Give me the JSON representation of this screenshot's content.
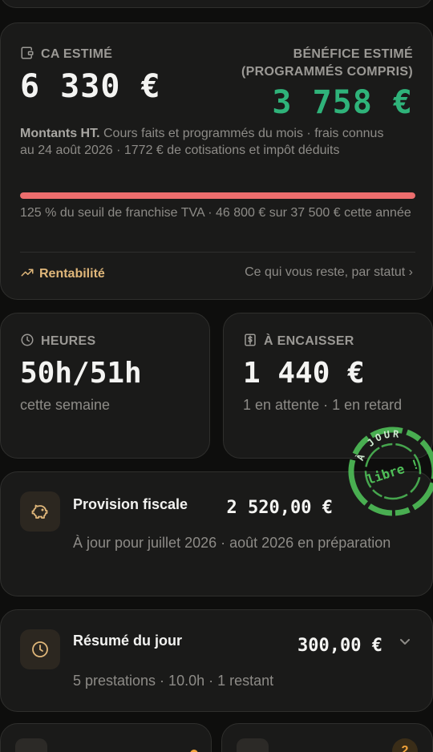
{
  "revenue_card": {
    "ca_label": "CA ESTIMÉ",
    "ca_value": "6 330 €",
    "benefice_label": "BÉNÉFICE ESTIMÉ (PROGRAMMÉS COMPRIS)",
    "benefice_value": "3 758 €",
    "desc_bold": "Montants HT.",
    "desc_text": " Cours faits et programmés du mois · frais connus au 24 août 2026 · 1772 € de cotisations et impôt déduits",
    "tva_progress_percent": 125,
    "tva_note": "125 % du seuil de franchise TVA · 46 800 € sur 37 500 € cette année",
    "rentabilite_link": "Rentabilité",
    "reste_link": "Ce qui vous reste, par statut ›",
    "colors": {
      "benefice": "#2fb37a",
      "progress": "#ec6d6d",
      "accent": "#e0b77a"
    }
  },
  "hours_card": {
    "label": "HEURES",
    "value": "50h/51h",
    "sub": "cette semaine",
    "icon": "clock-icon"
  },
  "cash_card": {
    "label": "À ENCAISSER",
    "value": "1 440 €",
    "sub": "1 en attente · 1 en retard",
    "icon": "dollar-doc-icon"
  },
  "stamp": {
    "top_text": "À JOUR",
    "center_text": "libre !"
  },
  "provision_card": {
    "title": "Provision fiscale",
    "amount": "2 520,00 €",
    "sub": "À jour pour juillet 2026 · août 2026 en préparation",
    "icon": "piggy-bank-icon"
  },
  "resume_card": {
    "title": "Résumé du jour",
    "amount": "300,00 €",
    "sub": "5 prestations · 10.0h · 1 restant",
    "icon": "clock-icon"
  },
  "bottom": {
    "badge": "2"
  }
}
